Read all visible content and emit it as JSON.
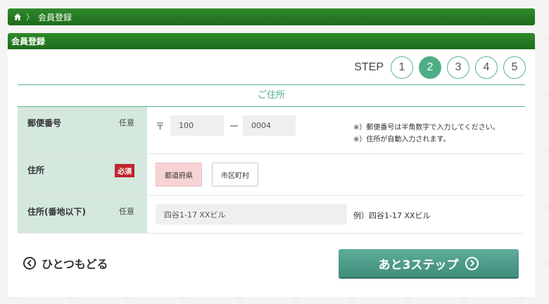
{
  "breadcrumb": {
    "home_icon": "home-icon",
    "separator": "〉",
    "current": "会員登録"
  },
  "panel": {
    "title": "会員登録"
  },
  "steps": {
    "label": "STEP",
    "items": [
      "1",
      "2",
      "3",
      "4",
      "5"
    ],
    "active": "2"
  },
  "section": {
    "title": "ご住所"
  },
  "form": {
    "postal": {
      "label": "郵便番号",
      "badge": "任意",
      "zip_mark": "〒",
      "zip1_value": "100",
      "dash": "ー",
      "zip2_value": "0004",
      "note_line1": "※）郵便番号は半角数字で入力してください。",
      "note_line2": "※）住所が自動入力されます。"
    },
    "address": {
      "label": "住所",
      "badge": "必須",
      "prefecture_button": "都道府県",
      "city_button": "市区町村"
    },
    "street": {
      "label": "住所(番地以下)",
      "badge": "任意",
      "placeholder": "四谷1-17 XXビル",
      "example": "例）四谷1-17 XXビル"
    }
  },
  "actions": {
    "back_label": "ひとつもどる",
    "next_label": "あと3ステップ"
  },
  "colors": {
    "header_green": "#2e8a2a",
    "accent_teal": "#4fae86",
    "label_bg": "#d4e8de",
    "required_red": "#c0272d",
    "prefecture_pink": "#f8d3d5"
  }
}
